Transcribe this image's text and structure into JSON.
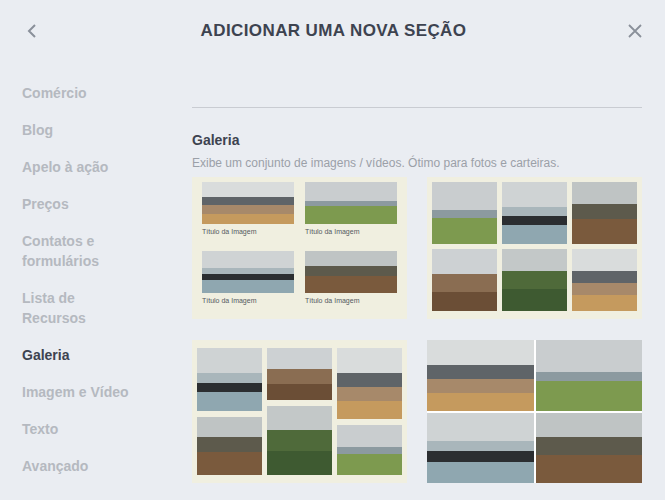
{
  "header": {
    "title": "ADICIONAR UMA NOVA SEÇÃO"
  },
  "sidebar": {
    "items": [
      {
        "label": "Comércio",
        "selected": false
      },
      {
        "label": "Blog",
        "selected": false
      },
      {
        "label": "Apelo à ação",
        "selected": false
      },
      {
        "label": "Preços",
        "selected": false
      },
      {
        "label": "Contatos e formulários",
        "selected": false
      },
      {
        "label": "Lista de Recursos",
        "selected": false
      },
      {
        "label": "Galeria",
        "selected": true
      },
      {
        "label": "Imagem e Vídeo",
        "selected": false
      },
      {
        "label": "Texto",
        "selected": false
      },
      {
        "label": "Avançado",
        "selected": false
      }
    ]
  },
  "section": {
    "title": "Galeria",
    "description": "Exibe um conjunto de imagens / vídeos. Ótimo para fotos e carteiras."
  },
  "layouts": [
    {
      "kind": "captioned",
      "captions": [
        "Título da Imagem",
        "Título da Imagem",
        "Título da Imagem",
        "Título da Imagem"
      ]
    },
    {
      "kind": "grid",
      "captions": []
    },
    {
      "kind": "masonry",
      "captions": []
    },
    {
      "kind": "mosaic",
      "captions": []
    }
  ]
}
